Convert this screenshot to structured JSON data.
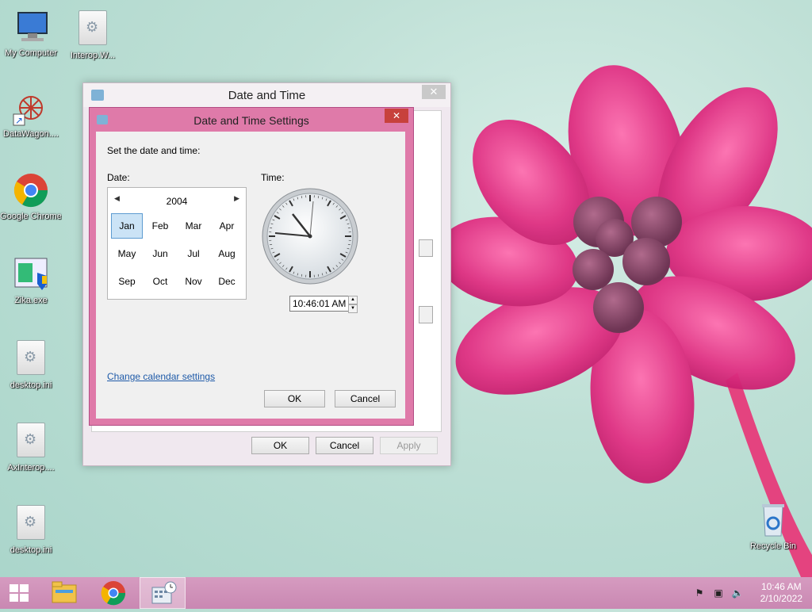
{
  "desktop": {
    "icons": [
      {
        "label": "My Computer",
        "icon": "computer-icon"
      },
      {
        "label": "Interop.W...",
        "icon": "dll-file-icon"
      },
      {
        "label": "DataWagon....",
        "icon": "datawagon-icon"
      },
      {
        "label": "Google Chrome",
        "icon": "chrome-icon"
      },
      {
        "label": "Zika.exe",
        "icon": "exe-icon"
      },
      {
        "label": "desktop.ini",
        "icon": "settings-file-icon"
      },
      {
        "label": "AxInterop....",
        "icon": "dll-file-icon"
      },
      {
        "label": "desktop.ini",
        "icon": "settings-file-icon"
      },
      {
        "label": "Recycle Bin",
        "icon": "recycle-bin-icon"
      }
    ]
  },
  "dt_window": {
    "title": "Date and Time",
    "close": "✕",
    "ok": "OK",
    "cancel": "Cancel",
    "apply": "Apply"
  },
  "settings": {
    "title": "Date and Time Settings",
    "close": "✕",
    "instruction": "Set the date and time:",
    "date_label": "Date:",
    "time_label": "Time:",
    "year": "2004",
    "months": [
      "Jan",
      "Feb",
      "Mar",
      "Apr",
      "May",
      "Jun",
      "Jul",
      "Aug",
      "Sep",
      "Oct",
      "Nov",
      "Dec"
    ],
    "selected_month": "Jan",
    "time_value": "10:46:01 AM",
    "change_calendar_link": "Change calendar settings",
    "ok": "OK",
    "cancel": "Cancel"
  },
  "taskbar": {
    "time": "10:46 AM",
    "date": "2/10/2022",
    "items": [
      "start-icon",
      "file-explorer-icon",
      "chrome-icon",
      "date-time-icon"
    ]
  },
  "colors": {
    "dialog_accent": "#df7aa9",
    "taskbar": "#d08fb8",
    "close_red": "#c7413c"
  }
}
